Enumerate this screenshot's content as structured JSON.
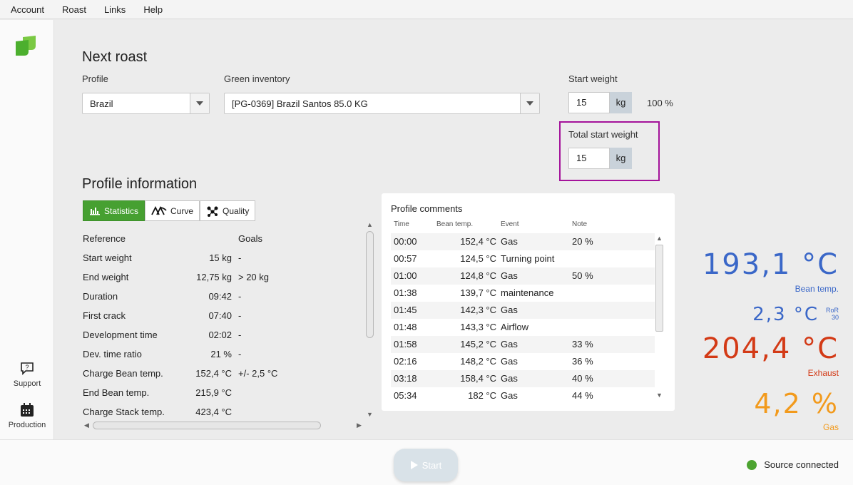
{
  "menu": [
    "Account",
    "Roast",
    "Links",
    "Help"
  ],
  "sidebar": {
    "support": "Support",
    "production": "Production"
  },
  "next_roast": {
    "title": "Next roast",
    "profile_label": "Profile",
    "profile_value": "Brazil",
    "inventory_label": "Green inventory",
    "inventory_value": "[PG-0369] Brazil Santos 85.0 KG",
    "start_weight_label": "Start weight",
    "start_weight_value": "15",
    "start_weight_unit": "kg",
    "start_weight_percent": "100 %",
    "total_weight_label": "Total start weight",
    "total_weight_value": "15",
    "total_weight_unit": "kg",
    "highlight_color": "#a4139a"
  },
  "profile_info": {
    "title": "Profile information",
    "tabs": [
      "Statistics",
      "Curve",
      "Quality"
    ],
    "active_tab": "Statistics",
    "col_reference": "Reference",
    "col_goals": "Goals",
    "rows": [
      {
        "k": "Start weight",
        "v": "15 kg",
        "g": "-"
      },
      {
        "k": "End weight",
        "v": "12,75 kg",
        "g": "> 20 kg"
      },
      {
        "k": "Duration",
        "v": "09:42",
        "g": "-"
      },
      {
        "k": "First crack",
        "v": "07:40",
        "g": "-"
      },
      {
        "k": "Development time",
        "v": "02:02",
        "g": "-"
      },
      {
        "k": "Dev. time ratio",
        "v": "21 %",
        "g": "-"
      },
      {
        "k": "Charge Bean temp.",
        "v": "152,4 °C",
        "g": "+/- 2,5 °C"
      },
      {
        "k": "End Bean temp.",
        "v": "215,9 °C",
        "g": ""
      },
      {
        "k": "Charge Stack temp.",
        "v": "423,4 °C",
        "g": ""
      }
    ]
  },
  "comments": {
    "title": "Profile comments",
    "headers": [
      "Time",
      "Bean temp.",
      "Event",
      "Note"
    ],
    "rows": [
      {
        "t": "00:00",
        "b": "152,4 °C",
        "e": "Gas",
        "n": "20 %"
      },
      {
        "t": "00:57",
        "b": "124,5 °C",
        "e": "Turning point",
        "n": ""
      },
      {
        "t": "01:00",
        "b": "124,8 °C",
        "e": "Gas",
        "n": "50 %"
      },
      {
        "t": "01:38",
        "b": "139,7 °C",
        "e": "maintenance",
        "n": ""
      },
      {
        "t": "01:45",
        "b": "142,3 °C",
        "e": "Gas",
        "n": ""
      },
      {
        "t": "01:48",
        "b": "143,3 °C",
        "e": "Airflow",
        "n": ""
      },
      {
        "t": "01:58",
        "b": "145,2 °C",
        "e": "Gas",
        "n": "33 %"
      },
      {
        "t": "02:16",
        "b": "148,2 °C",
        "e": "Gas",
        "n": "36 %"
      },
      {
        "t": "03:18",
        "b": "158,4 °C",
        "e": "Gas",
        "n": "40 %"
      },
      {
        "t": "05:34",
        "b": "182 °C",
        "e": "Gas",
        "n": "44 %"
      }
    ]
  },
  "readings": {
    "bean_temp": "193,1 °C",
    "bean_temp_label": "Bean temp.",
    "bean_color": "#3a67c8",
    "ror": "2,3 °C",
    "ror_label_top": "RoR",
    "ror_label_bottom": "30",
    "exhaust": "204,4 °C",
    "exhaust_label": "Exhaust",
    "exhaust_color": "#d33a16",
    "gas": "4,2 %",
    "gas_label": "Gas",
    "gas_color": "#f29a1c"
  },
  "bottom": {
    "start_label": "Start",
    "status_text": "Source connected",
    "status_color": "#4ca330"
  }
}
